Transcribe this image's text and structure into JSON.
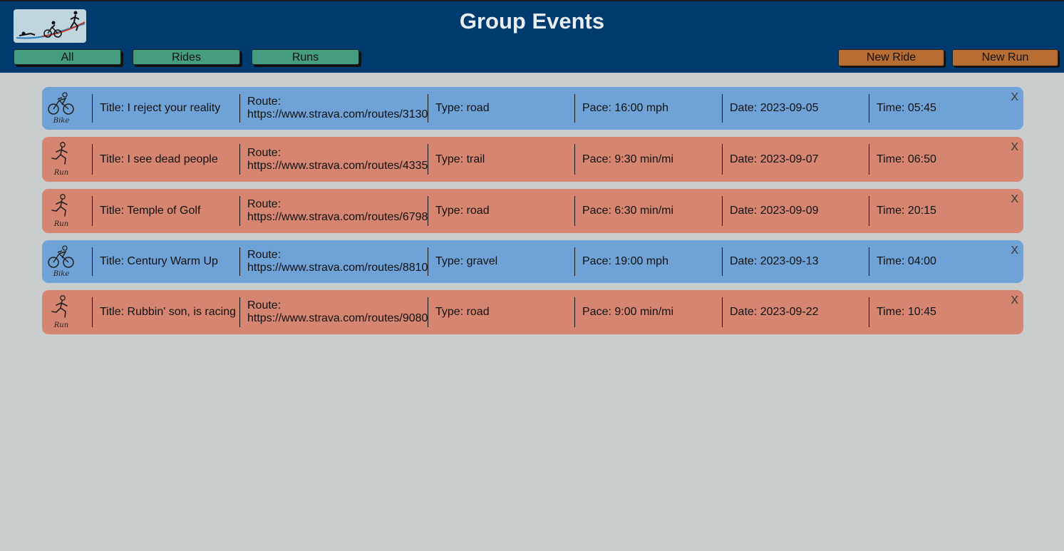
{
  "header": {
    "title": "Group Events",
    "filters": [
      "All",
      "Rides",
      "Runs"
    ],
    "new_ride": "New Ride",
    "new_run": "New Run"
  },
  "colors": {
    "header": "#003b6f",
    "ride": "#6fa3d7",
    "run": "#d68670",
    "filter_button": "#459c80",
    "create_button": "#b86d32",
    "background": "#c9cdce"
  },
  "events": [
    {
      "kind": "ride",
      "icon": "bike-icon",
      "icon_label": "Bike",
      "title": "Title: I reject your reality",
      "route_label": "Route:",
      "route_url": "https://www.strava.com/routes/3130",
      "type": "Type: road",
      "pace": "Pace: 16:00 mph",
      "date": "Date: 2023-09-05",
      "time": "Time: 05:45",
      "close": "X"
    },
    {
      "kind": "run",
      "icon": "run-icon",
      "icon_label": "Run",
      "title": "Title: I see dead people",
      "route_label": "Route:",
      "route_url": "https://www.strava.com/routes/4335",
      "type": "Type: trail",
      "pace": "Pace: 9:30 min/mi",
      "date": "Date: 2023-09-07",
      "time": "Time: 06:50",
      "close": "X"
    },
    {
      "kind": "run",
      "icon": "run-icon",
      "icon_label": "Run",
      "title": "Title: Temple of Golf",
      "route_label": "Route:",
      "route_url": "https://www.strava.com/routes/6798",
      "type": "Type: road",
      "pace": "Pace: 6:30 min/mi",
      "date": "Date: 2023-09-09",
      "time": "Time: 20:15",
      "close": "X"
    },
    {
      "kind": "ride",
      "icon": "bike-icon",
      "icon_label": "Bike",
      "title": "Title: Century Warm Up",
      "route_label": "Route:",
      "route_url": "https://www.strava.com/routes/8810",
      "type": "Type: gravel",
      "pace": "Pace: 19:00 mph",
      "date": "Date: 2023-09-13",
      "time": "Time: 04:00",
      "close": "X"
    },
    {
      "kind": "run",
      "icon": "run-icon",
      "icon_label": "Run",
      "title": "Title: Rubbin' son, is racing",
      "route_label": "Route:",
      "route_url": "https://www.strava.com/routes/9080",
      "type": "Type: road",
      "pace": "Pace: 9:00 min/mi",
      "date": "Date: 2023-09-22",
      "time": "Time: 10:45",
      "close": "X"
    }
  ]
}
